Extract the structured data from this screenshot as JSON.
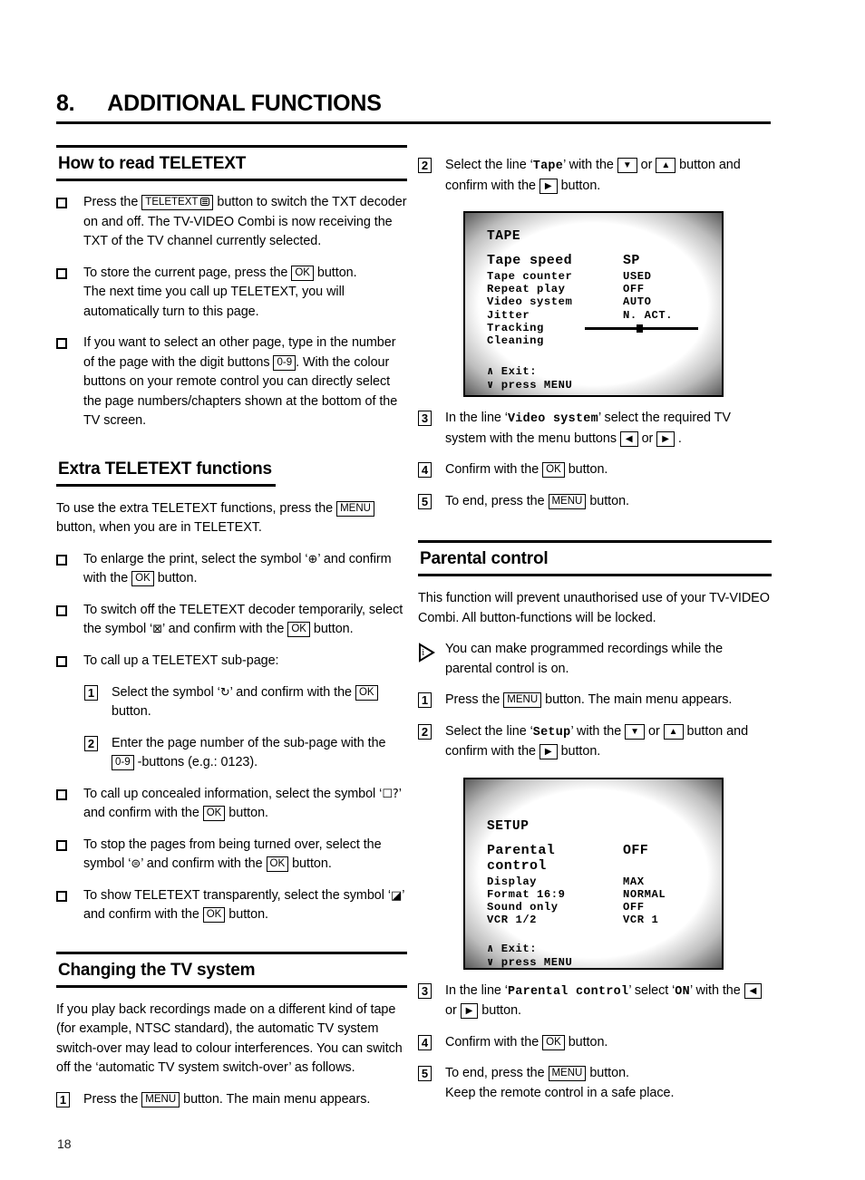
{
  "chapter": {
    "number": "8.",
    "title": "ADDITIONAL FUNCTIONS"
  },
  "page_number": "18",
  "keys": {
    "teletext": "TELETEXT",
    "ok": "OK",
    "menu": "MENU",
    "digits": "0-9",
    "down": "▼",
    "up": "▲",
    "left": "◀",
    "right": "▶"
  },
  "left_column": {
    "section1": {
      "title": "How to read TELETEXT",
      "items": [
        {
          "marker": "checkbox",
          "parts": [
            {
              "t": "text",
              "v": "Press the "
            },
            {
              "t": "key-teletext",
              "v": "TELETEXT"
            },
            {
              "t": "text",
              "v": " button to switch the TXT decoder on and off. The TV-VIDEO Combi is now receiving the TXT of the TV channel currently selected."
            }
          ]
        },
        {
          "marker": "checkbox",
          "parts": [
            {
              "t": "text",
              "v": "To store the current page, press the "
            },
            {
              "t": "key",
              "v": "OK"
            },
            {
              "t": "text",
              "v": " button."
            },
            {
              "t": "br",
              "v": ""
            },
            {
              "t": "text",
              "v": "The next time you call up TELETEXT, you will automatically turn to this page."
            }
          ]
        },
        {
          "marker": "checkbox",
          "parts": [
            {
              "t": "text",
              "v": "If you want to select an other page, type in the number of the page with the digit buttons "
            },
            {
              "t": "key",
              "v": "0-9"
            },
            {
              "t": "text",
              "v": ". With the colour buttons on your remote control you can directly select the page numbers/chapters shown at the bottom of the TV screen."
            }
          ]
        }
      ]
    },
    "section2": {
      "title": "Extra TELETEXT functions",
      "intro_parts": [
        {
          "t": "text",
          "v": "To use the extra TELETEXT functions, press the "
        },
        {
          "t": "key",
          "v": "MENU"
        },
        {
          "t": "text",
          "v": " button, when you are in TELETEXT."
        }
      ],
      "items": [
        {
          "marker": "checkbox",
          "parts": [
            {
              "t": "text",
              "v": "To enlarge the print, select the symbol ‘"
            },
            {
              "t": "symbol",
              "v": "⊕",
              "name": "enlarge-print-symbol"
            },
            {
              "t": "text",
              "v": "’ and confirm with the "
            },
            {
              "t": "key",
              "v": "OK"
            },
            {
              "t": "text",
              "v": " button."
            }
          ]
        },
        {
          "marker": "checkbox",
          "parts": [
            {
              "t": "text",
              "v": "To switch off the TELETEXT decoder temporarily, select the symbol ‘"
            },
            {
              "t": "symbol",
              "v": "⊠",
              "name": "teletext-off-symbol"
            },
            {
              "t": "text",
              "v": "’ and confirm with the "
            },
            {
              "t": "key",
              "v": "OK"
            },
            {
              "t": "text",
              "v": " button."
            }
          ]
        },
        {
          "marker": "checkbox",
          "parts": [
            {
              "t": "text",
              "v": "To call up a TELETEXT sub-page:"
            }
          ],
          "substeps": [
            {
              "marker": "1",
              "parts": [
                {
                  "t": "text",
                  "v": "Select the symbol ‘"
                },
                {
                  "t": "symbol",
                  "v": "↻",
                  "name": "sub-page-symbol"
                },
                {
                  "t": "text",
                  "v": "’ and confirm with the "
                },
                {
                  "t": "key",
                  "v": "OK"
                },
                {
                  "t": "text",
                  "v": " button."
                }
              ]
            },
            {
              "marker": "2",
              "parts": [
                {
                  "t": "text",
                  "v": "Enter the page number of the sub-page with the "
                },
                {
                  "t": "key",
                  "v": "0-9"
                },
                {
                  "t": "text",
                  "v": " -buttons (e.g.: 0123)."
                }
              ]
            }
          ]
        },
        {
          "marker": "checkbox",
          "parts": [
            {
              "t": "text",
              "v": "To call up concealed information, select the symbol ‘"
            },
            {
              "t": "symbol",
              "v": "☐?",
              "name": "concealed-info-symbol"
            },
            {
              "t": "text",
              "v": "’ and confirm with the "
            },
            {
              "t": "key",
              "v": "OK"
            },
            {
              "t": "text",
              "v": " button."
            }
          ]
        },
        {
          "marker": "checkbox",
          "parts": [
            {
              "t": "text",
              "v": "To stop the pages from being turned over, select the symbol ‘"
            },
            {
              "t": "symbol",
              "v": "⊜",
              "name": "hold-page-symbol"
            },
            {
              "t": "text",
              "v": "’ and confirm with the "
            },
            {
              "t": "key",
              "v": "OK"
            },
            {
              "t": "text",
              "v": " button."
            }
          ]
        },
        {
          "marker": "checkbox",
          "parts": [
            {
              "t": "text",
              "v": "To show TELETEXT transparently, select the symbol ‘"
            },
            {
              "t": "symbol",
              "v": "◪",
              "name": "transparent-symbol"
            },
            {
              "t": "text",
              "v": "’ and confirm with the "
            },
            {
              "t": "key",
              "v": "OK"
            },
            {
              "t": "text",
              "v": " button."
            }
          ]
        }
      ]
    },
    "section3": {
      "title": "Changing the TV system",
      "intro": "If you play back recordings made on a different kind of tape (for example, NTSC standard), the automatic TV system switch-over may lead to colour interferences. You can switch off the ‘automatic TV system switch-over’ as follows.",
      "items": [
        {
          "marker": "1",
          "parts": [
            {
              "t": "text",
              "v": "Press the "
            },
            {
              "t": "key",
              "v": "MENU"
            },
            {
              "t": "text",
              "v": " button. The main menu appears."
            }
          ]
        }
      ]
    }
  },
  "right_column": {
    "tv_system_steps_top": [
      {
        "marker": "2",
        "parts": [
          {
            "t": "text",
            "v": "Select the line ‘"
          },
          {
            "t": "mono",
            "v": "Tape"
          },
          {
            "t": "text",
            "v": "’ with the "
          },
          {
            "t": "key-arrow",
            "v": "▼"
          },
          {
            "t": "text",
            "v": " or "
          },
          {
            "t": "key-arrow",
            "v": "▲"
          },
          {
            "t": "text",
            "v": " button and confirm with the "
          },
          {
            "t": "key-arrow",
            "v": "▶"
          },
          {
            "t": "text",
            "v": " button."
          }
        ]
      }
    ],
    "tape_screen": {
      "title": "TAPE",
      "highlight_row": {
        "label": "Tape speed",
        "value": "SP"
      },
      "rows": [
        {
          "label": "Tape counter",
          "value": "USED"
        },
        {
          "label": "Repeat play",
          "value": "OFF"
        },
        {
          "label": "Video system",
          "value": "AUTO"
        },
        {
          "label": "Jitter",
          "value": "N. ACT."
        },
        {
          "label": "Tracking",
          "value": "",
          "slider": true
        },
        {
          "label": "Cleaning",
          "value": ""
        }
      ],
      "exit_line1": "∧ Exit:",
      "exit_line2": "∨ press MENU"
    },
    "tv_system_steps_bottom": [
      {
        "marker": "3",
        "parts": [
          {
            "t": "text",
            "v": "In the line ‘"
          },
          {
            "t": "mono",
            "v": "Video system"
          },
          {
            "t": "text",
            "v": "’ select the required TV system with the menu buttons "
          },
          {
            "t": "key-arrow",
            "v": "◀"
          },
          {
            "t": "text",
            "v": " or "
          },
          {
            "t": "key-arrow",
            "v": "▶"
          },
          {
            "t": "text",
            "v": " ."
          }
        ]
      },
      {
        "marker": "4",
        "parts": [
          {
            "t": "text",
            "v": "Confirm with the "
          },
          {
            "t": "key",
            "v": "OK"
          },
          {
            "t": "text",
            "v": " button."
          }
        ]
      },
      {
        "marker": "5",
        "parts": [
          {
            "t": "text",
            "v": "To end, press the "
          },
          {
            "t": "key",
            "v": "MENU"
          },
          {
            "t": "text",
            "v": " button."
          }
        ]
      }
    ],
    "parental": {
      "title": "Parental control",
      "intro": "This function will prevent unauthorised use of your TV-VIDEO Combi. All button-functions will be locked.",
      "note": "You can make programmed recordings while the parental control is on.",
      "steps_top": [
        {
          "marker": "1",
          "parts": [
            {
              "t": "text",
              "v": "Press the "
            },
            {
              "t": "key",
              "v": "MENU"
            },
            {
              "t": "text",
              "v": " button. The main menu appears."
            }
          ]
        },
        {
          "marker": "2",
          "parts": [
            {
              "t": "text",
              "v": "Select the line ‘"
            },
            {
              "t": "mono",
              "v": "Setup"
            },
            {
              "t": "text",
              "v": "’ with the "
            },
            {
              "t": "key-arrow",
              "v": "▼"
            },
            {
              "t": "text",
              "v": " or "
            },
            {
              "t": "key-arrow",
              "v": "▲"
            },
            {
              "t": "text",
              "v": " button and confirm with the "
            },
            {
              "t": "key-arrow",
              "v": "▶"
            },
            {
              "t": "text",
              "v": " button."
            }
          ]
        }
      ],
      "setup_screen": {
        "title": "SETUP",
        "highlight_row": {
          "label": "Parental control",
          "value": "OFF"
        },
        "rows": [
          {
            "label": "Display",
            "value": "MAX"
          },
          {
            "label": "Format 16:9",
            "value": "NORMAL"
          },
          {
            "label": "Sound only",
            "value": "OFF"
          },
          {
            "label": "VCR 1/2",
            "value": "VCR 1"
          }
        ],
        "exit_line1": "∧ Exit:",
        "exit_line2": "∨ press MENU"
      },
      "steps_bottom": [
        {
          "marker": "3",
          "parts": [
            {
              "t": "text",
              "v": "In the line ‘"
            },
            {
              "t": "mono",
              "v": "Parental control"
            },
            {
              "t": "text",
              "v": "’ select ‘"
            },
            {
              "t": "mono",
              "v": "ON"
            },
            {
              "t": "text",
              "v": "’ with the "
            },
            {
              "t": "key-arrow",
              "v": "◀"
            },
            {
              "t": "text",
              "v": " or "
            },
            {
              "t": "key-arrow",
              "v": "▶"
            },
            {
              "t": "text",
              "v": " button."
            }
          ]
        },
        {
          "marker": "4",
          "parts": [
            {
              "t": "text",
              "v": "Confirm with the "
            },
            {
              "t": "key",
              "v": "OK"
            },
            {
              "t": "text",
              "v": " button."
            }
          ]
        },
        {
          "marker": "5",
          "parts": [
            {
              "t": "text",
              "v": "To end, press the "
            },
            {
              "t": "key",
              "v": "MENU"
            },
            {
              "t": "text",
              "v": " button."
            },
            {
              "t": "br",
              "v": ""
            },
            {
              "t": "text",
              "v": "Keep the remote control in a safe place."
            }
          ]
        }
      ]
    }
  }
}
